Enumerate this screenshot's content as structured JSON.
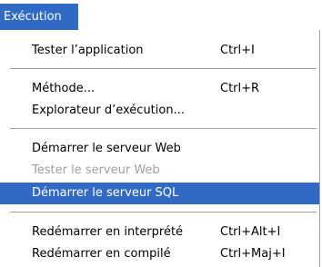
{
  "menu_title": "Exécution",
  "items": [
    {
      "label": "Tester l’application",
      "shortcut": "Ctrl+I"
    },
    {
      "label": "Méthode...",
      "shortcut": "Ctrl+R"
    },
    {
      "label": "Explorateur d’exécution...",
      "shortcut": ""
    },
    {
      "label": "Démarrer le serveur Web",
      "shortcut": ""
    },
    {
      "label": "Tester le serveur Web",
      "shortcut": "",
      "disabled": true
    },
    {
      "label": "Démarrer le serveur SQL",
      "shortcut": "",
      "highlighted": true
    },
    {
      "label": "Redémarrer en interprété",
      "shortcut": "Ctrl+Alt+I"
    },
    {
      "label": "Redémarrer en compilé",
      "shortcut": "Ctrl+Maj+I"
    }
  ],
  "colors": {
    "highlight": "#316ac5",
    "disabled_text": "#a0a0a0",
    "separator": "#a0a0a0"
  }
}
